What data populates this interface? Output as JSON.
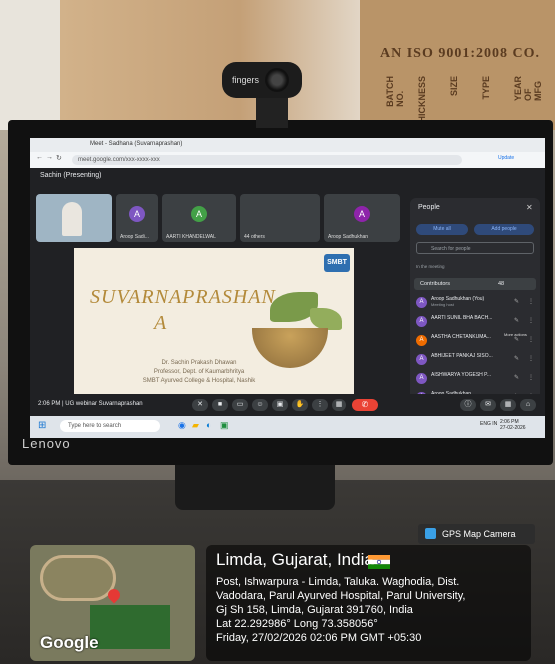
{
  "background": {
    "cardboard_stamp": "AN ISO 9001:2008 CO.",
    "cardboard_columns": [
      "BATCH NO.",
      "THICKNESS",
      "SIZE",
      "TYPE",
      "YEAR OF MFG"
    ],
    "webcam_brand": "fingers",
    "monitor_brand": "Lenovo"
  },
  "screen": {
    "browser": {
      "tab_title": "Meet - Sadhana (Suvarnaprashan)",
      "url": "meet.google.com/xxx-xxxx-xxx",
      "update_label": "Update"
    },
    "meet": {
      "presenting_label": "Sachin (Presenting)",
      "tiles": [
        {
          "name": "",
          "initial": "",
          "color": "#4a6e8a"
        },
        {
          "name": "Aroop Sadi...",
          "initial": "A",
          "color": "#7e57c2"
        },
        {
          "name": "AARTI KHANDELWAL",
          "initial": "A",
          "color": "#43a047"
        },
        {
          "name": "44 others",
          "initial": "",
          "color": "#5c6bc0"
        },
        {
          "name": "Aroop Sadhukhan",
          "initial": "A",
          "color": "#8e24aa"
        }
      ],
      "slide": {
        "title_line1": "SUVARNAPRASHAN",
        "title_line2": "A",
        "logo": "SMBT",
        "presenter_name": "Dr. Sachin Prakash Dhawan",
        "presenter_role": "Professor, Dept. of Kaumarbhritya",
        "presenter_institution": "SMBT Ayurved College & Hospital, Nashik"
      },
      "bottom_bar": {
        "time": "2:06 PM",
        "meeting_name": "UG webinar Suvarnaprashan"
      }
    },
    "people_panel": {
      "title": "People",
      "mute_all": "Mute all",
      "add_people": "Add people",
      "search_placeholder": "Search for people",
      "section_label": "In the meeting",
      "contributors_label": "Contributors",
      "contributors_count": "48",
      "participants": [
        {
          "name": "Aroop Sadhukhan (You)",
          "sub": "Meeting host",
          "initial": "A",
          "color": "#7e57c2"
        },
        {
          "name": "AARTI SUNIL BHA BACH...",
          "sub": "",
          "initial": "A",
          "color": "#7e57c2"
        },
        {
          "name": "AASTHA CHETANKUMA...",
          "sub": "",
          "initial": "A",
          "color": "#ef6c00"
        },
        {
          "name": "ABHIJEET PANKAJ SISO...",
          "sub": "",
          "initial": "A",
          "color": "#7e57c2"
        },
        {
          "name": "AISHWARYA YOGESH P...",
          "sub": "",
          "initial": "A",
          "color": "#7e57c2"
        },
        {
          "name": "Aroop Sadhukhan",
          "sub": "Meeting host",
          "initial": "A",
          "color": "#7e57c2"
        }
      ],
      "more_actions_label": "More actions"
    },
    "taskbar": {
      "search_placeholder": "Type here to search",
      "lang": "ENG IN",
      "clock_time": "2:06 PM",
      "clock_date": "27-02-2026"
    }
  },
  "gps": {
    "badge": "GPS Map Camera",
    "city": "Limda, Gujarat, India",
    "address_lines": [
      "Post, Ishwarpura - Limda, Taluka. Waghodia, Dist.",
      "Vadodara, Parul Ayurved Hospital, Parul University,",
      "Gj Sh 158, Limda, Gujarat 391760, India"
    ],
    "coords": "Lat 22.292986° Long 73.358056°",
    "datetime": "Friday, 27/02/2026 02:06 PM GMT +05:30",
    "map_brand": "Google"
  }
}
